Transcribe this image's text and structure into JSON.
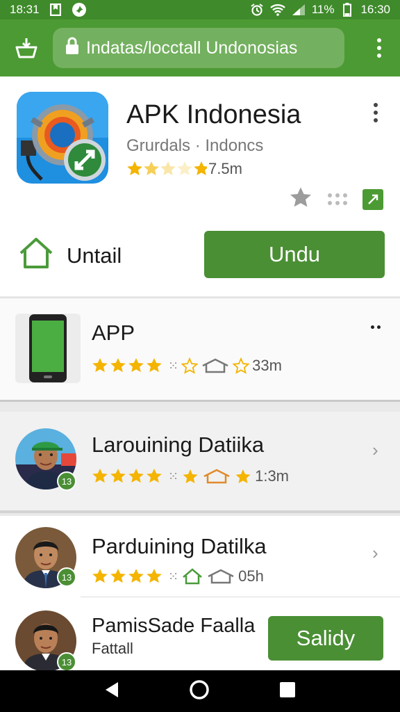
{
  "status": {
    "time_left": "18:31",
    "battery": "11%",
    "time_right": "16:30"
  },
  "browser": {
    "url": "Indatas/locctall Undonosias"
  },
  "app": {
    "title": "APK Indonesia",
    "subtitle": "Grurdals · Indoncs",
    "rating_text": "7.5m",
    "install_label": "Untail",
    "download_label": "Undu"
  },
  "app_card": {
    "title": "APP",
    "rating_text": "33m"
  },
  "list": [
    {
      "title": "Larouining Datiika",
      "badge": "13",
      "rating_text": "1:3m"
    },
    {
      "title": "Parduining Datilka",
      "badge": "13",
      "rating_text": "05h"
    },
    {
      "title": "PamisSade Faalla",
      "subtitle": "Fattall",
      "badge": "13",
      "button_label": "Salidy"
    }
  ],
  "colors": {
    "accent": "#4c9a33",
    "star": "#f4b400"
  },
  "icons": [
    "home-basket-icon",
    "lock-icon",
    "more-vert-icon",
    "star-icon",
    "grid-icon",
    "share-icon",
    "house-icon",
    "chevron-right-icon",
    "back-icon",
    "home-circle-icon",
    "recents-icon"
  ]
}
